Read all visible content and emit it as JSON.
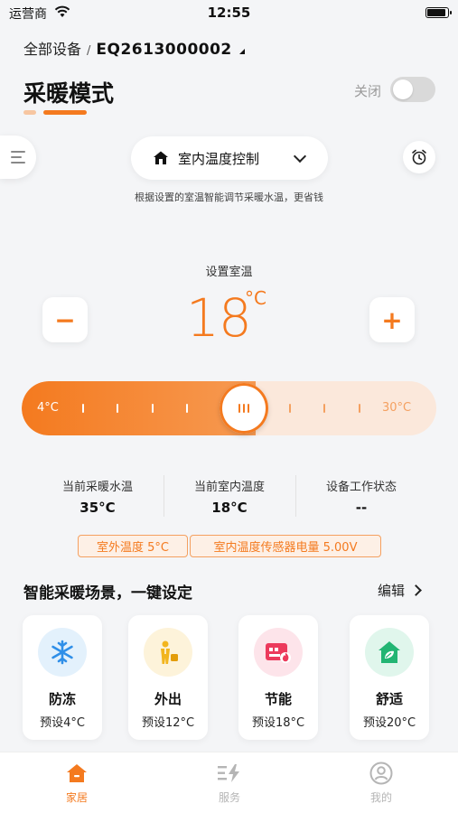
{
  "status_bar": {
    "carrier": "运营商",
    "time": "12:55"
  },
  "header": {
    "all_devices": "全部设备",
    "separator": "/",
    "device_id": "EQ2613000002",
    "mode_title": "采暖模式",
    "toggle_label": "关闭",
    "toggle_on": false
  },
  "control": {
    "mode_select_label": "室内温度控制",
    "description": "根据设置的室温智能调节采暖水温，更省钱"
  },
  "temperature": {
    "label": "设置室温",
    "value": "18",
    "unit": "°C",
    "minus_label": "−",
    "plus_label": "+",
    "slider": {
      "min_label": "4°C",
      "max_label": "30°C",
      "min": 4,
      "max": 30,
      "value": 18
    }
  },
  "stats": [
    {
      "label": "当前采暖水温",
      "value": "35°C"
    },
    {
      "label": "当前室内温度",
      "value": "18°C"
    },
    {
      "label": "设备工作状态",
      "value": "--"
    }
  ],
  "badges": {
    "outdoor": "室外温度 5°C",
    "sensor": "室内温度传感器电量 5.00V"
  },
  "scenes": {
    "title": "智能采暖场景，一键设定",
    "edit": "编辑",
    "items": [
      {
        "name": "防冻",
        "preset": "预设4°C",
        "icon": "snowflake-icon",
        "bg": "#e3f1fc",
        "color": "#2f8fe8"
      },
      {
        "name": "外出",
        "preset": "预设12°C",
        "icon": "person-going-out-icon",
        "bg": "#fdf3da",
        "color": "#f2b51e"
      },
      {
        "name": "节能",
        "preset": "预设18°C",
        "icon": "energy-saving-icon",
        "bg": "#fde4ea",
        "color": "#ec3a5c"
      },
      {
        "name": "舒适",
        "preset": "预设20°C",
        "icon": "comfort-home-icon",
        "bg": "#e0f6ec",
        "color": "#22b573"
      }
    ]
  },
  "tabbar": [
    {
      "label": "家居",
      "icon": "home-icon",
      "active": true
    },
    {
      "label": "服务",
      "icon": "service-icon",
      "active": false
    },
    {
      "label": "我的",
      "icon": "profile-icon",
      "active": false
    }
  ],
  "colors": {
    "accent": "#f47a1f",
    "accent_light": "#fbe8db",
    "inactive": "#b5b5b5"
  }
}
